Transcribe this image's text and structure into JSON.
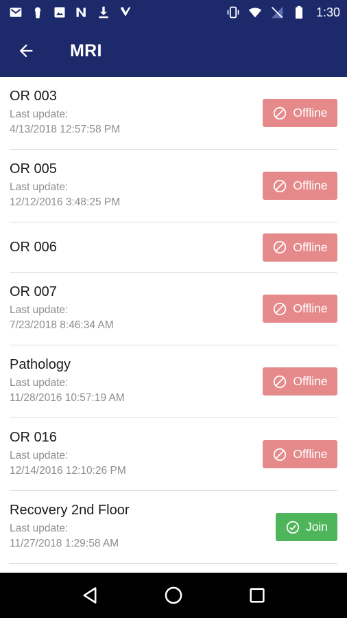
{
  "status_bar": {
    "time": "1:30",
    "left_icons": [
      "gmail-icon",
      "keyhole-icon",
      "image-icon",
      "n-app-icon",
      "download-icon",
      "check-app-icon"
    ],
    "right_icons": [
      "vibrate-icon",
      "wifi-icon",
      "no-signal-icon",
      "battery-icon"
    ]
  },
  "app_bar": {
    "title": "MRI",
    "background": "#1c2a6b"
  },
  "colors": {
    "offline": "#e5898a",
    "join": "#4fb55a"
  },
  "rooms": [
    {
      "name": "OR 003",
      "update_label": "Last update:",
      "update_time": "4/13/2018 12:57:58 PM",
      "status": "Offline"
    },
    {
      "name": "OR 005",
      "update_label": "Last update:",
      "update_time": "12/12/2016 3:48:25 PM",
      "status": "Offline"
    },
    {
      "name": "OR 006",
      "update_label": "",
      "update_time": "",
      "status": "Offline"
    },
    {
      "name": "OR 007",
      "update_label": "Last update:",
      "update_time": "7/23/2018 8:46:34 AM",
      "status": "Offline"
    },
    {
      "name": "Pathology",
      "update_label": "Last update:",
      "update_time": "11/28/2016 10:57:19 AM",
      "status": "Offline"
    },
    {
      "name": "OR 016",
      "update_label": "Last update:",
      "update_time": "12/14/2016 12:10:26 PM",
      "status": "Offline"
    },
    {
      "name": "Recovery 2nd Floor",
      "update_label": "Last update:",
      "update_time": "11/27/2018 1:29:58 AM",
      "status": "Join"
    }
  ],
  "nav": [
    "back-triangle-icon",
    "home-circle-icon",
    "recents-square-icon"
  ]
}
